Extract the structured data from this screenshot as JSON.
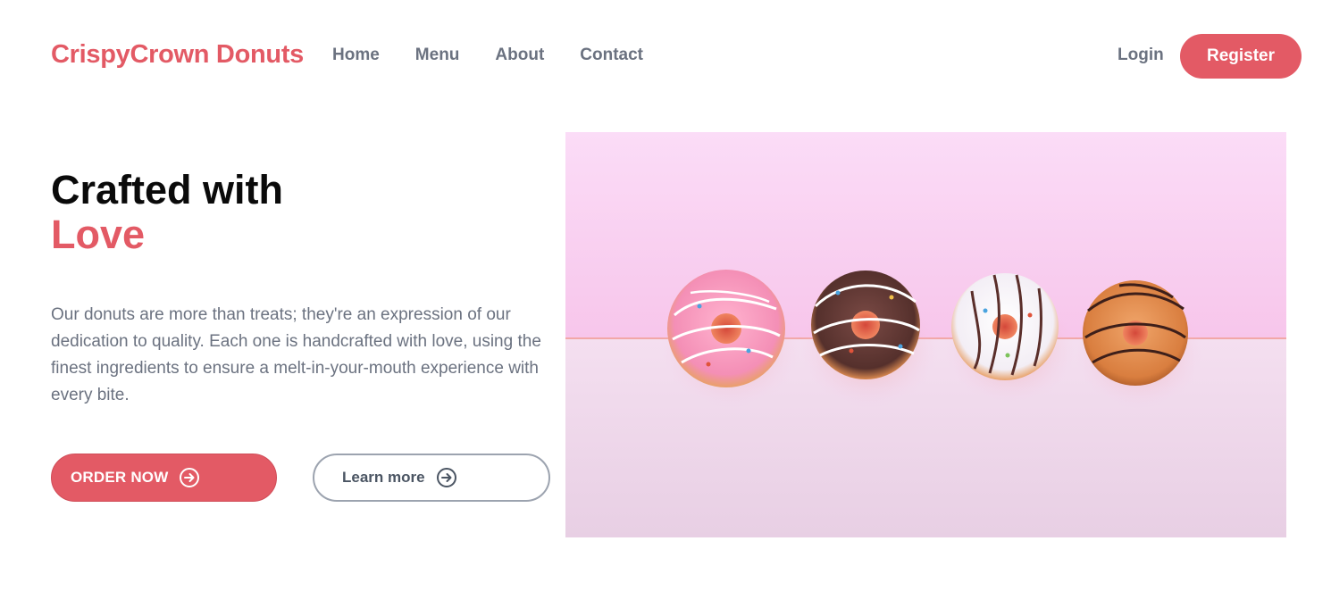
{
  "nav": {
    "brand": "CrispyCrown Donuts",
    "links": [
      "Home",
      "Menu",
      "About",
      "Contact"
    ],
    "login": "Login",
    "register": "Register"
  },
  "hero": {
    "title_line1": "Crafted with",
    "title_line2": "Love",
    "description": "Our donuts are more than treats; they're an expression of our dedication to quality. Each one is handcrafted with love, using the finest ingredients to ensure a melt-in-your-mouth experience with every bite.",
    "order_button": "ORDER NOW",
    "learn_button": "Learn more"
  },
  "image": {
    "subject": "four glazed donuts in a row on a pink background",
    "donuts": [
      "pink-glazed-icon",
      "chocolate-glazed-icon",
      "white-glazed-icon",
      "caramel-glazed-icon"
    ]
  },
  "colors": {
    "accent": "#e35a65",
    "nav_text": "#6b7280",
    "heading": "#0a0a0a"
  },
  "icons": {
    "order_arrow": "arrow-right-circle-icon",
    "learn_arrow": "arrow-right-circle-icon"
  }
}
